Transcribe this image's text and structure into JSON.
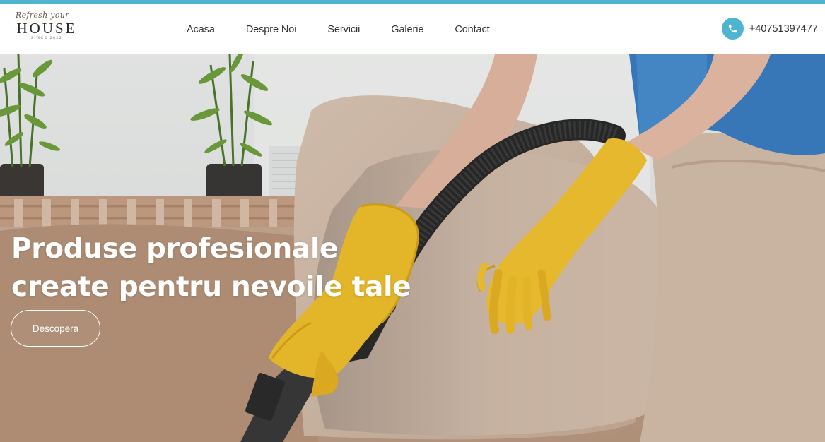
{
  "brand": {
    "logo_script": "Refresh your",
    "logo_word": "HOUSE",
    "logo_since": "SINCE 2022"
  },
  "nav": {
    "items": [
      {
        "label": "Acasa"
      },
      {
        "label": "Despre Noi"
      },
      {
        "label": "Servicii"
      },
      {
        "label": "Galerie"
      },
      {
        "label": "Contact"
      }
    ]
  },
  "contact": {
    "phone": "+40751397477",
    "icon": "phone-icon"
  },
  "hero": {
    "title_line1": "Produse profesionale",
    "title_line2": "create pentru nevoile tale",
    "cta_label": "Descopera",
    "image": "photo of person in yellow gloves vacuuming a beige sofa"
  },
  "colors": {
    "accent": "#4fb4cf",
    "text": "#333333",
    "hero_text": "#ffffff"
  }
}
